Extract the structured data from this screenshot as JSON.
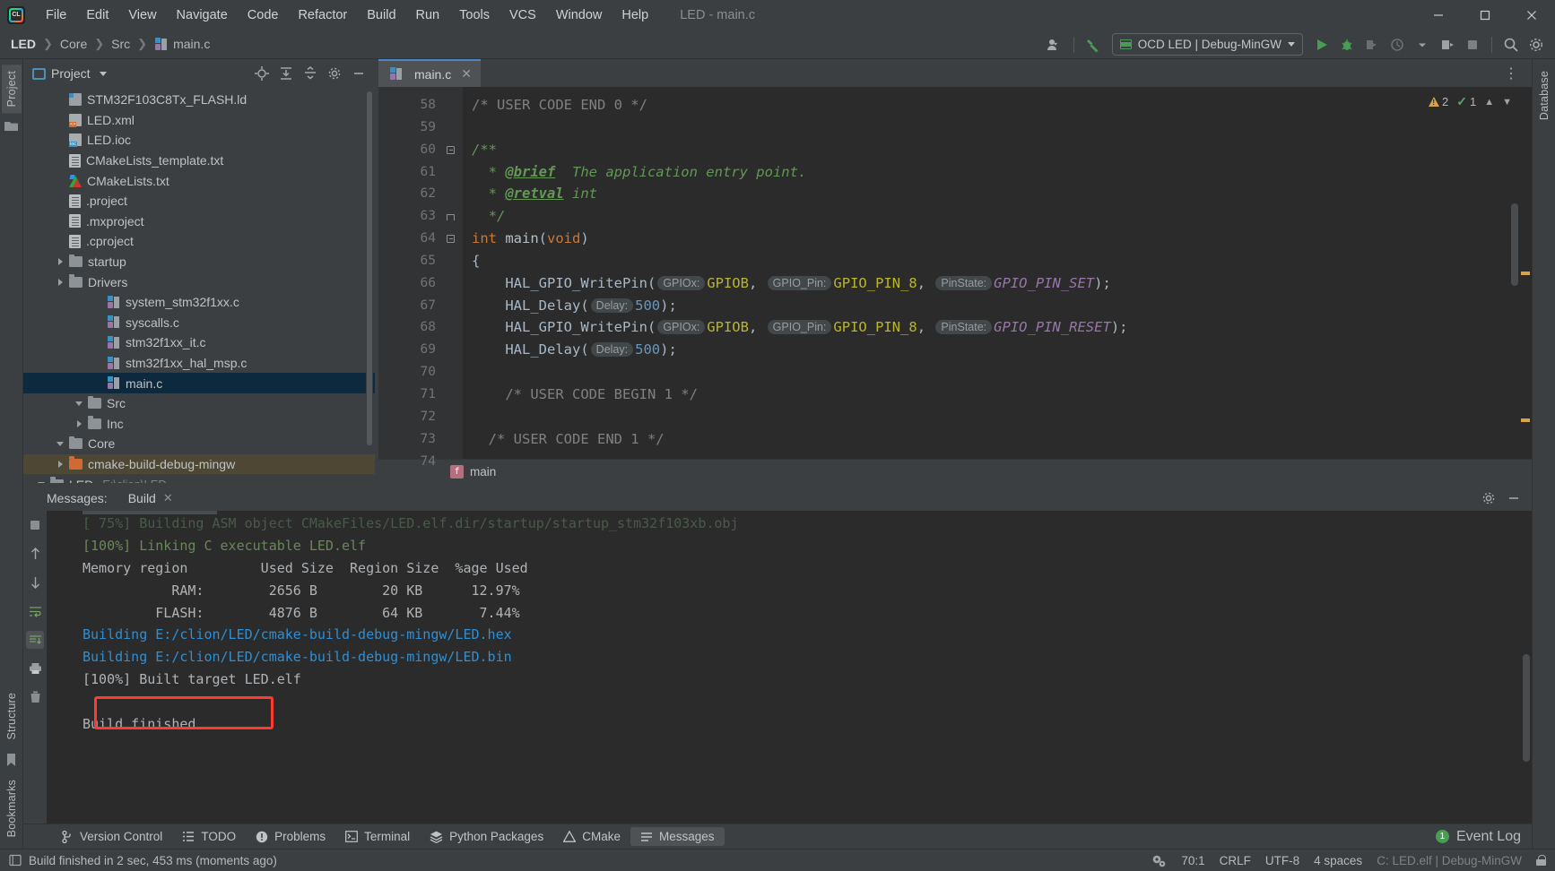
{
  "app": {
    "logo_text": "CL",
    "window_title": "LED - main.c"
  },
  "menubar": {
    "items": [
      {
        "label": "File"
      },
      {
        "label": "Edit"
      },
      {
        "label": "View"
      },
      {
        "label": "Navigate"
      },
      {
        "label": "Code"
      },
      {
        "label": "Refactor"
      },
      {
        "label": "Build"
      },
      {
        "label": "Run"
      },
      {
        "label": "Tools"
      },
      {
        "label": "VCS"
      },
      {
        "label": "Window"
      },
      {
        "label": "Help"
      }
    ],
    "window_controls": {
      "minimize": "—",
      "maximize": "☐",
      "close": "✕"
    }
  },
  "navbar": {
    "breadcrumbs": [
      {
        "label": "LED"
      },
      {
        "label": "Core"
      },
      {
        "label": "Src"
      },
      {
        "label": "main.c"
      }
    ],
    "run_config": {
      "label": "OCD LED | Debug-MinGW",
      "icon": "chip-icon",
      "accent": "#499c54"
    },
    "icons": [
      {
        "name": "user-account-icon"
      },
      {
        "name": "hammer-build-icon"
      },
      {
        "name": "run-icon"
      },
      {
        "name": "debug-icon"
      },
      {
        "name": "attach-icon"
      },
      {
        "name": "run-with-coverage-icon"
      },
      {
        "name": "more-run-icon"
      },
      {
        "name": "stop-icon"
      },
      {
        "name": "search-everywhere-icon"
      },
      {
        "name": "settings-gear-icon"
      }
    ]
  },
  "left_strip": {
    "tabs": [
      {
        "label": "Project",
        "active": true
      }
    ],
    "icons": [
      {
        "name": "structure-icon"
      }
    ],
    "bottom_tabs": [
      {
        "label": "Structure"
      },
      {
        "label": "Bookmarks"
      }
    ]
  },
  "right_strip": {
    "tabs": [
      {
        "label": "Database"
      }
    ]
  },
  "project_panel": {
    "title": "Project",
    "header_icons": [
      {
        "name": "locate-target-icon"
      },
      {
        "name": "expand-all-icon"
      },
      {
        "name": "collapse-all-icon"
      },
      {
        "name": "settings-gear-icon"
      },
      {
        "name": "hide-panel-icon"
      }
    ],
    "tree": [
      {
        "label": "LED",
        "suffix": "E:\\clion\\LED",
        "icon": "folder",
        "arrow": "down",
        "indent": 0,
        "state": "normal"
      },
      {
        "label": "cmake-build-debug-mingw",
        "icon": "folder-orange",
        "arrow": "right",
        "indent": 1,
        "state": "highlight"
      },
      {
        "label": "Core",
        "icon": "folder",
        "arrow": "down",
        "indent": 1,
        "state": "normal"
      },
      {
        "label": "Inc",
        "icon": "folder",
        "arrow": "right",
        "indent": 2,
        "state": "normal"
      },
      {
        "label": "Src",
        "icon": "folder",
        "arrow": "down",
        "indent": 2,
        "state": "normal"
      },
      {
        "label": "main.c",
        "icon": "c-file",
        "arrow": "none",
        "indent": 3,
        "state": "selected"
      },
      {
        "label": "stm32f1xx_hal_msp.c",
        "icon": "c-file",
        "arrow": "none",
        "indent": 3,
        "state": "normal"
      },
      {
        "label": "stm32f1xx_it.c",
        "icon": "c-file",
        "arrow": "none",
        "indent": 3,
        "state": "normal"
      },
      {
        "label": "syscalls.c",
        "icon": "c-file",
        "arrow": "none",
        "indent": 3,
        "state": "normal"
      },
      {
        "label": "system_stm32f1xx.c",
        "icon": "c-file",
        "arrow": "none",
        "indent": 3,
        "state": "normal"
      },
      {
        "label": "Drivers",
        "icon": "folder",
        "arrow": "right",
        "indent": 1,
        "state": "normal"
      },
      {
        "label": "startup",
        "icon": "folder",
        "arrow": "right",
        "indent": 1,
        "state": "normal"
      },
      {
        "label": ".cproject",
        "icon": "doc",
        "arrow": "none",
        "indent": 1,
        "state": "normal"
      },
      {
        "label": ".mxproject",
        "icon": "doc",
        "arrow": "none",
        "indent": 1,
        "state": "normal"
      },
      {
        "label": ".project",
        "icon": "doc",
        "arrow": "none",
        "indent": 1,
        "state": "normal"
      },
      {
        "label": "CMakeLists.txt",
        "icon": "cmake",
        "arrow": "none",
        "indent": 1,
        "state": "normal"
      },
      {
        "label": "CMakeLists_template.txt",
        "icon": "doc",
        "arrow": "none",
        "indent": 1,
        "state": "normal"
      },
      {
        "label": "LED.ioc",
        "icon": "ioc",
        "arrow": "none",
        "indent": 1,
        "state": "normal"
      },
      {
        "label": "LED.xml",
        "icon": "xml",
        "arrow": "none",
        "indent": 1,
        "state": "normal"
      },
      {
        "label": "STM32F103C8Tx_FLASH.ld",
        "icon": "ld",
        "arrow": "none",
        "indent": 1,
        "state": "normal"
      }
    ]
  },
  "editor": {
    "tab": {
      "label": "main.c",
      "close": "✕"
    },
    "kebab": "⋮",
    "inspections": {
      "warnings": "2",
      "checks": "1",
      "up": "⌃",
      "down": "⌄"
    },
    "first_line": 58,
    "lines": [
      {
        "n": 58,
        "fold": "none",
        "runmark": false
      },
      {
        "n": 59,
        "fold": "none",
        "runmark": false
      },
      {
        "n": 60,
        "fold": "start",
        "runmark": false
      },
      {
        "n": 61,
        "fold": "none",
        "runmark": false
      },
      {
        "n": 62,
        "fold": "none",
        "runmark": false
      },
      {
        "n": 63,
        "fold": "end",
        "runmark": false
      },
      {
        "n": 64,
        "fold": "start",
        "runmark": true
      },
      {
        "n": 65,
        "fold": "none",
        "runmark": false
      },
      {
        "n": 66,
        "fold": "none",
        "runmark": false
      },
      {
        "n": 67,
        "fold": "none",
        "runmark": false
      },
      {
        "n": 68,
        "fold": "none",
        "runmark": false
      },
      {
        "n": 69,
        "fold": "none",
        "runmark": false
      },
      {
        "n": 70,
        "fold": "none",
        "runmark": false
      },
      {
        "n": 71,
        "fold": "none",
        "runmark": false
      },
      {
        "n": 72,
        "fold": "none",
        "runmark": false
      },
      {
        "n": 73,
        "fold": "none",
        "runmark": false
      },
      {
        "n": 74,
        "fold": "none",
        "runmark": false
      }
    ],
    "code_text": [
      "/* USER CODE END 0 */",
      "",
      "/**",
      "  * @brief  The application entry point.",
      "  * @retval int",
      "  */",
      "int main(void)",
      "{",
      "    HAL_GPIO_WritePin( GPIOx: GPIOB,  GPIO_Pin: GPIO_PIN_8,  PinState: GPIO_PIN_SET);",
      "    HAL_Delay( Delay: 500);",
      "    HAL_GPIO_WritePin( GPIOx: GPIOB,  GPIO_Pin: GPIO_PIN_8,  PinState: GPIO_PIN_RESET);",
      "    HAL_Delay( Delay: 500);",
      "",
      "    /* USER CODE BEGIN 1 */",
      "",
      "  /* USER CODE END 1 */",
      ""
    ],
    "hints": [
      "GPIOx:",
      "GPIO_Pin:",
      "PinState:",
      "Delay:"
    ],
    "footer_breadcrumb": {
      "label": "main",
      "badge": "f"
    }
  },
  "messages_panel": {
    "label": "Messages:",
    "tab": {
      "label": "Build",
      "close": "✕"
    },
    "header_icons": [
      {
        "name": "settings-gear-icon"
      },
      {
        "name": "hide-panel-icon"
      }
    ],
    "side_icons": [
      {
        "name": "stop-icon"
      },
      {
        "name": "up-arrow-icon"
      },
      {
        "name": "down-arrow-icon"
      },
      {
        "name": "soft-wrap-icon"
      },
      {
        "name": "scroll-to-end-icon"
      },
      {
        "name": "print-icon"
      },
      {
        "name": "trash-icon"
      }
    ],
    "console_lines": [
      {
        "text": "[ 75%] Building ASM object CMakeFiles/LED.elf.dir/startup/startup_stm32f103xb.obj",
        "style": "faint"
      },
      {
        "text": "[100%] Linking C executable LED.elf",
        "style": "green"
      },
      {
        "text": "Memory region         Used Size  Region Size  %age Used",
        "style": "gray"
      },
      {
        "text": "           RAM:        2656 B        20 KB      12.97%",
        "style": "gray"
      },
      {
        "text": "         FLASH:        4876 B        64 KB       7.44%",
        "style": "gray"
      },
      {
        "text": "Building E:/clion/LED/cmake-build-debug-mingw/LED.hex",
        "style": "blue"
      },
      {
        "text": "Building E:/clion/LED/cmake-build-debug-mingw/LED.bin",
        "style": "blue"
      },
      {
        "text": "[100%] Built target LED.elf",
        "style": "gray"
      },
      {
        "text": "",
        "style": "gray"
      },
      {
        "text": "Build finished",
        "style": "gray"
      }
    ],
    "memory_table": {
      "headers": [
        "Memory region",
        "Used Size",
        "Region Size",
        "%age Used"
      ],
      "rows": [
        {
          "region": "RAM:",
          "used": "2656 B",
          "size": "20 KB",
          "pct": "12.97%"
        },
        {
          "region": "FLASH:",
          "used": "4876 B",
          "size": "64 KB",
          "pct": "7.44%"
        }
      ]
    },
    "annotation": {
      "target": "Build finished",
      "color": "#ff3b30"
    }
  },
  "bottom_toolbar": {
    "items": [
      {
        "label": "Version Control",
        "icon": "branch-icon",
        "active": false
      },
      {
        "label": "TODO",
        "icon": "list-icon",
        "active": false
      },
      {
        "label": "Problems",
        "icon": "exclamation-circle-icon",
        "active": false
      },
      {
        "label": "Terminal",
        "icon": "terminal-icon",
        "active": false
      },
      {
        "label": "Python Packages",
        "icon": "layers-icon",
        "active": false
      },
      {
        "label": "CMake",
        "icon": "triangle-icon",
        "active": false
      },
      {
        "label": "Messages",
        "icon": "messages-icon",
        "active": true
      }
    ],
    "event_log": {
      "label": "Event Log",
      "count": "1"
    }
  },
  "statusbar": {
    "message": "Build finished in 2 sec, 453 ms (moments ago)",
    "caret": "70:1",
    "line_sep": "CRLF",
    "encoding": "UTF-8",
    "indent": "4 spaces",
    "config": "C: LED.elf | Debug-MinGW",
    "icons": [
      {
        "name": "inspections-icon"
      },
      {
        "name": "lock-icon"
      }
    ]
  }
}
